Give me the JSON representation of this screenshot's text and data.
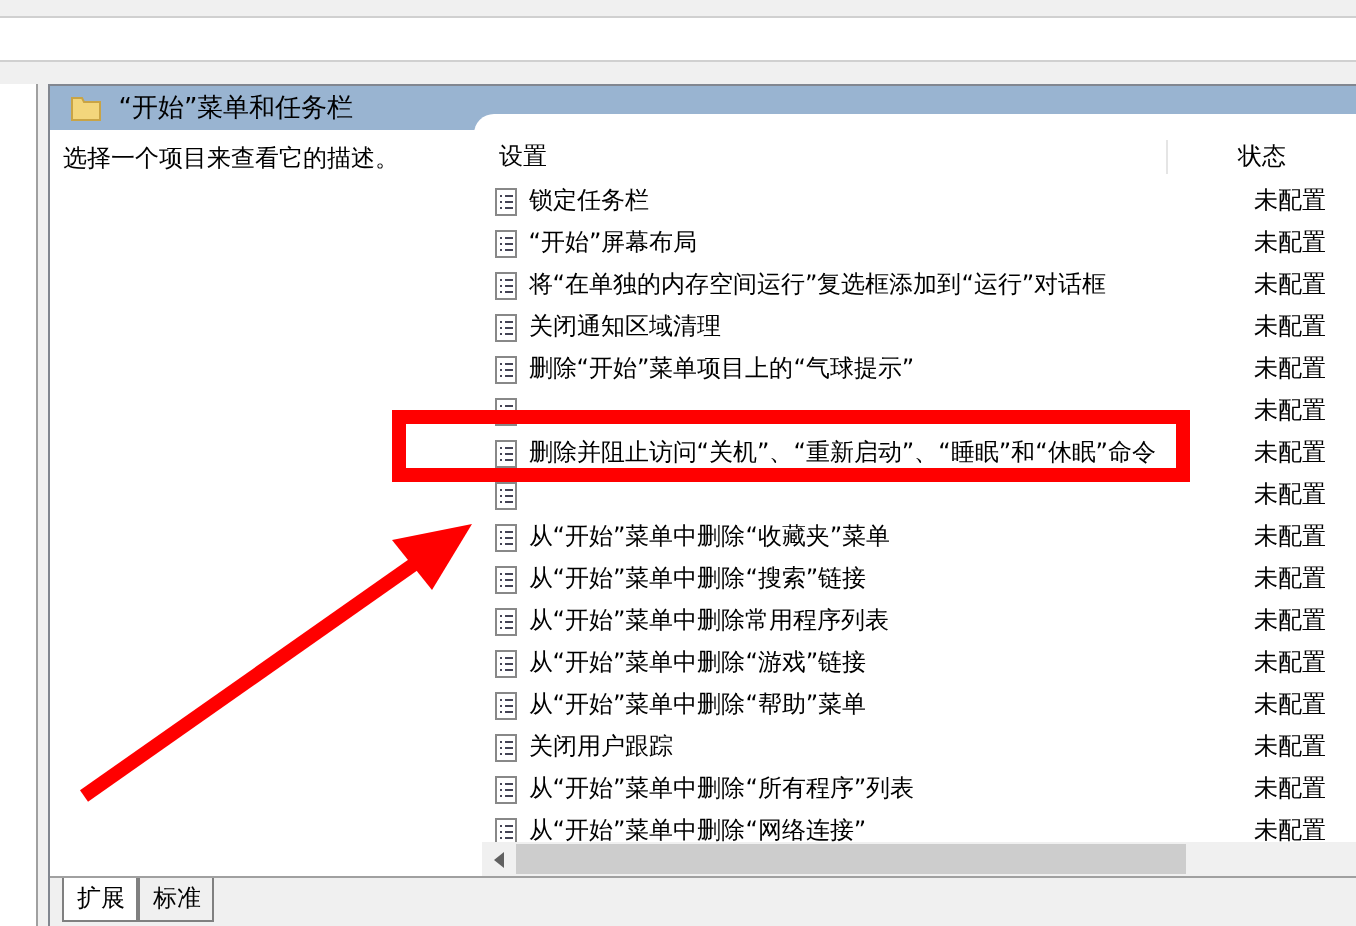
{
  "panel": {
    "title": "“开始”菜单和任务栏",
    "description": "选择一个项目来查看它的描述。"
  },
  "table": {
    "columns": [
      "设置",
      "状态"
    ],
    "rows": [
      {
        "setting": "锁定任务栏",
        "state": "未配置"
      },
      {
        "setting": "“开始”屏幕布局",
        "state": "未配置"
      },
      {
        "setting": "将“在单独的内存空间运行”复选框添加到“运行”对话框",
        "state": "未配置"
      },
      {
        "setting": "关闭通知区域清理",
        "state": "未配置"
      },
      {
        "setting": "删除“开始”菜单项目上的“气球提示”",
        "state": "未配置"
      },
      {
        "state": "未配置"
      },
      {
        "setting": "删除并阻止访问“关机”、“重新启动”、“睡眠”和“休眠”命令",
        "state": "未配置"
      },
      {
        "state": "未配置"
      },
      {
        "setting": "从“开始”菜单中删除“收藏夹”菜单",
        "state": "未配置"
      },
      {
        "setting": "从“开始”菜单中删除“搜索”链接",
        "state": "未配置"
      },
      {
        "setting": "从“开始”菜单中删除常用程序列表",
        "state": "未配置"
      },
      {
        "setting": "从“开始”菜单中删除“游戏”链接",
        "state": "未配置"
      },
      {
        "setting": "从“开始”菜单中删除“帮助”菜单",
        "state": "未配置"
      },
      {
        "setting": "关闭用户跟踪",
        "state": "未配置"
      },
      {
        "setting": "从“开始”菜单中删除“所有程序”列表",
        "state": "未配置"
      },
      {
        "setting": "从“开始”菜单中删除“网络连接”",
        "state": "未配置"
      }
    ]
  },
  "tabs": [
    {
      "label": "扩展",
      "selected": true
    },
    {
      "label": "标准",
      "selected": false
    }
  ]
}
